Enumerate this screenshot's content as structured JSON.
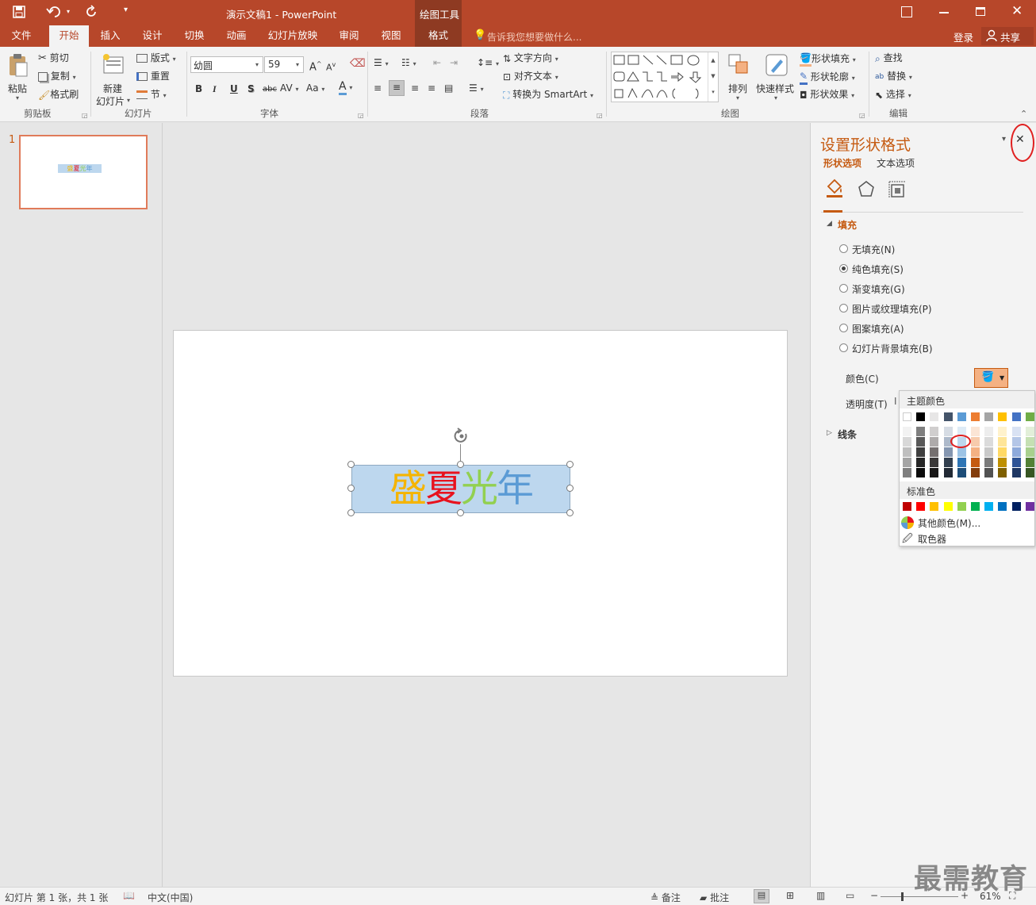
{
  "window": {
    "title": "演示文稿1 - PowerPoint",
    "context_tab_group": "绘图工具"
  },
  "tabs": [
    {
      "label": "文件"
    },
    {
      "label": "开始",
      "active": true
    },
    {
      "label": "插入"
    },
    {
      "label": "设计"
    },
    {
      "label": "切换"
    },
    {
      "label": "动画"
    },
    {
      "label": "幻灯片放映"
    },
    {
      "label": "审阅"
    },
    {
      "label": "视图"
    },
    {
      "label": "格式"
    }
  ],
  "tell_me": "告诉我您想要做什么...",
  "account": {
    "login": "登录",
    "share": "共享"
  },
  "ribbon": {
    "clipboard": {
      "paste": "粘贴",
      "cut": "剪切",
      "copy": "复制",
      "format_painter": "格式刷",
      "label": "剪贴板"
    },
    "slides": {
      "new_slide_1": "新建",
      "new_slide_2": "幻灯片",
      "layout": "版式",
      "reset": "重置",
      "section": "节",
      "label": "幻灯片"
    },
    "font": {
      "name": "幼圆",
      "size": "59",
      "label": "字体",
      "bold": "B",
      "italic": "I",
      "underline": "U",
      "shadow": "S",
      "strike": "abc",
      "spacing": "AV",
      "case": "Aa",
      "color_letter": "A",
      "grow": "A",
      "shrink": "A"
    },
    "paragraph": {
      "text_direction": "文字方向",
      "align_text": "对齐文本",
      "smartart": "转换为 SmartArt",
      "label": "段落"
    },
    "drawing": {
      "arrange": "排列",
      "quick_styles": "快速样式",
      "shape_fill": "形状填充",
      "shape_outline": "形状轮廓",
      "shape_effects": "形状效果",
      "label": "绘图"
    },
    "editing": {
      "find": "查找",
      "replace": "替换",
      "select": "选择",
      "label": "编辑"
    }
  },
  "thumbnail": {
    "number": "1"
  },
  "slide": {
    "textbox_chars": [
      {
        "char": "盛",
        "color": "#f5b400"
      },
      {
        "char": "夏",
        "color": "#e8121e"
      },
      {
        "char": "光",
        "color": "#92d050"
      },
      {
        "char": "年",
        "color": "#5b9bd5"
      }
    ],
    "textbox_fill": "#bdd7ee"
  },
  "format_pane": {
    "title": "设置形状格式",
    "tab_shape": "形状选项",
    "tab_text": "文本选项",
    "fill_section": "填充",
    "options": [
      {
        "label": "无填充(N)",
        "selected": false
      },
      {
        "label": "纯色填充(S)",
        "selected": true
      },
      {
        "label": "渐变填充(G)",
        "selected": false
      },
      {
        "label": "图片或纹理填充(P)",
        "selected": false
      },
      {
        "label": "图案填充(A)",
        "selected": false
      },
      {
        "label": "幻灯片背景填充(B)",
        "selected": false
      }
    ],
    "color_label": "颜色(C)",
    "transparency_label": "透明度(T)",
    "line_section": "线条"
  },
  "color_popup": {
    "theme_label": "主题颜色",
    "standard_label": "标准色",
    "more_colors": "其他颜色(M)...",
    "eyedropper": "取色器",
    "theme_top": [
      "#ffffff",
      "#000000",
      "#e7e6e6",
      "#44546a",
      "#5b9bd5",
      "#ed7d31",
      "#a5a5a5",
      "#ffc000",
      "#4472c4",
      "#70ad47"
    ],
    "theme_shades": [
      [
        "#f2f2f2",
        "#7f7f7f",
        "#d0cece",
        "#d6dce4",
        "#deebf6",
        "#fbe5d5",
        "#ededed",
        "#fff2cc",
        "#d9e2f3",
        "#e2efd9"
      ],
      [
        "#d8d8d8",
        "#595959",
        "#aeabab",
        "#adb9ca",
        "#bdd7ee",
        "#f7cbac",
        "#dbdbdb",
        "#fee599",
        "#b4c6e7",
        "#c5e0b3"
      ],
      [
        "#bfbfbf",
        "#3f3f3f",
        "#757070",
        "#8496b0",
        "#9cc3e5",
        "#f4b183",
        "#c9c9c9",
        "#ffd965",
        "#8eaadb",
        "#a8d08d"
      ],
      [
        "#a5a5a5",
        "#262626",
        "#3a3838",
        "#323f4f",
        "#2e75b5",
        "#c55a11",
        "#7b7b7b",
        "#bf9000",
        "#2f5496",
        "#538135"
      ],
      [
        "#7f7f7f",
        "#0c0c0c",
        "#171616",
        "#222a35",
        "#1e4e79",
        "#833c0b",
        "#525252",
        "#7f6000",
        "#1f3864",
        "#375623"
      ]
    ],
    "standard": [
      "#c00000",
      "#ff0000",
      "#ffc000",
      "#ffff00",
      "#92d050",
      "#00b050",
      "#00b0f0",
      "#0070c0",
      "#002060",
      "#7030a0"
    ]
  },
  "status": {
    "slide_info": "幻灯片 第 1 张，共 1 张",
    "language": "中文(中国)",
    "notes": "备注",
    "comments": "批注",
    "zoom": "61%"
  },
  "watermark": "最需教育"
}
